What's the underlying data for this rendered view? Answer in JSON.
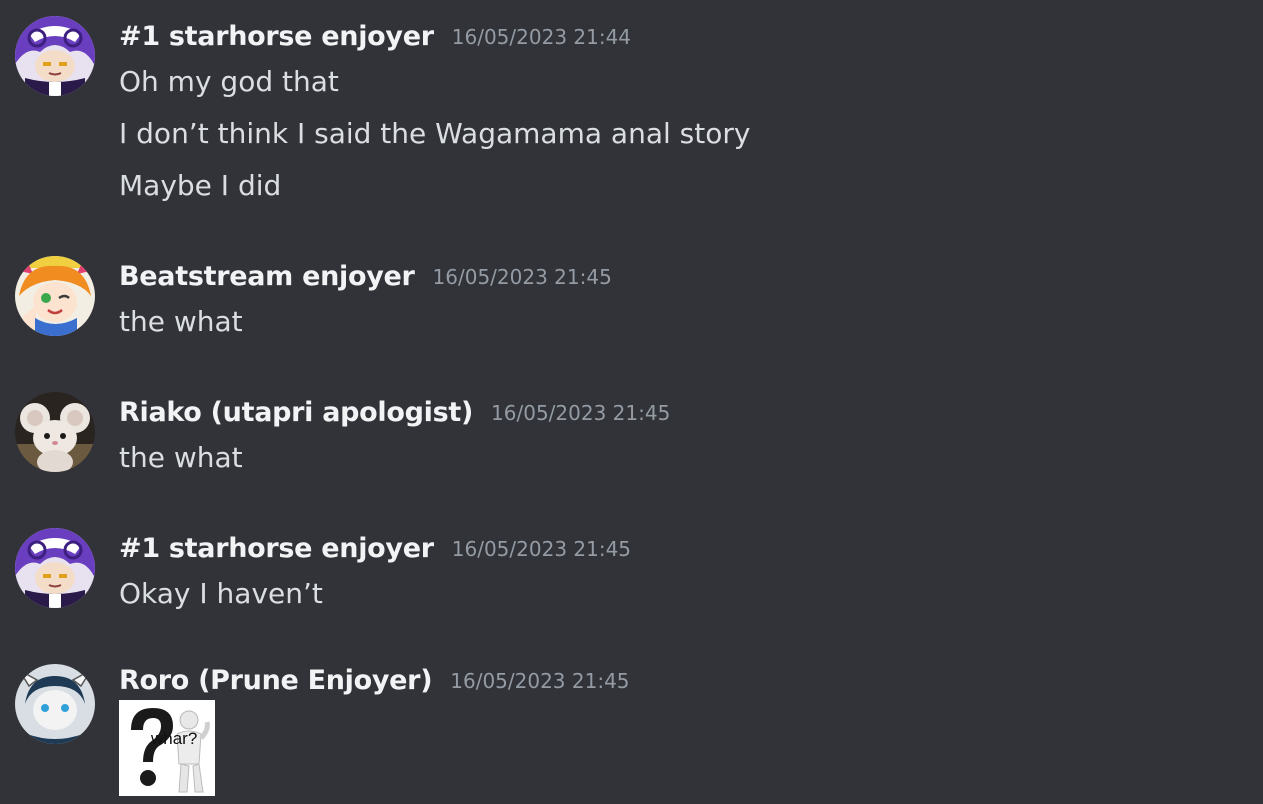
{
  "messages": [
    {
      "author": "#1 starhorse enjoyer",
      "timestamp": "16/05/2023 21:44",
      "avatar_icon": "purple-hair-anime-avatar-icon",
      "lines": [
        "Oh my god that",
        "I don’t think I said the Wagamama anal story",
        "Maybe I did"
      ]
    },
    {
      "author": "Beatstream enjoyer",
      "timestamp": "16/05/2023 21:45",
      "avatar_icon": "orange-hair-anime-avatar-icon",
      "lines": [
        "the what"
      ]
    },
    {
      "author": "Riako (utapri apologist)",
      "timestamp": "16/05/2023 21:45",
      "avatar_icon": "plush-mouse-avatar-icon",
      "lines": [
        "the what"
      ]
    },
    {
      "author": "#1 starhorse enjoyer",
      "timestamp": "16/05/2023 21:45",
      "avatar_icon": "purple-hair-anime-avatar-icon",
      "lines": [
        "Okay I haven’t"
      ]
    },
    {
      "author": "Roro (Prune Enjoyer)",
      "timestamp": "16/05/2023 21:45",
      "avatar_icon": "horned-character-avatar-icon",
      "lines": [],
      "attachment": {
        "icon": "question-mark-figure-meme-icon",
        "caption_text": "whar?"
      }
    }
  ],
  "colors": {
    "background": "#313338",
    "author": "#f2f3f5",
    "timestamp": "#949ba4",
    "message_text": "#dbdee1"
  }
}
